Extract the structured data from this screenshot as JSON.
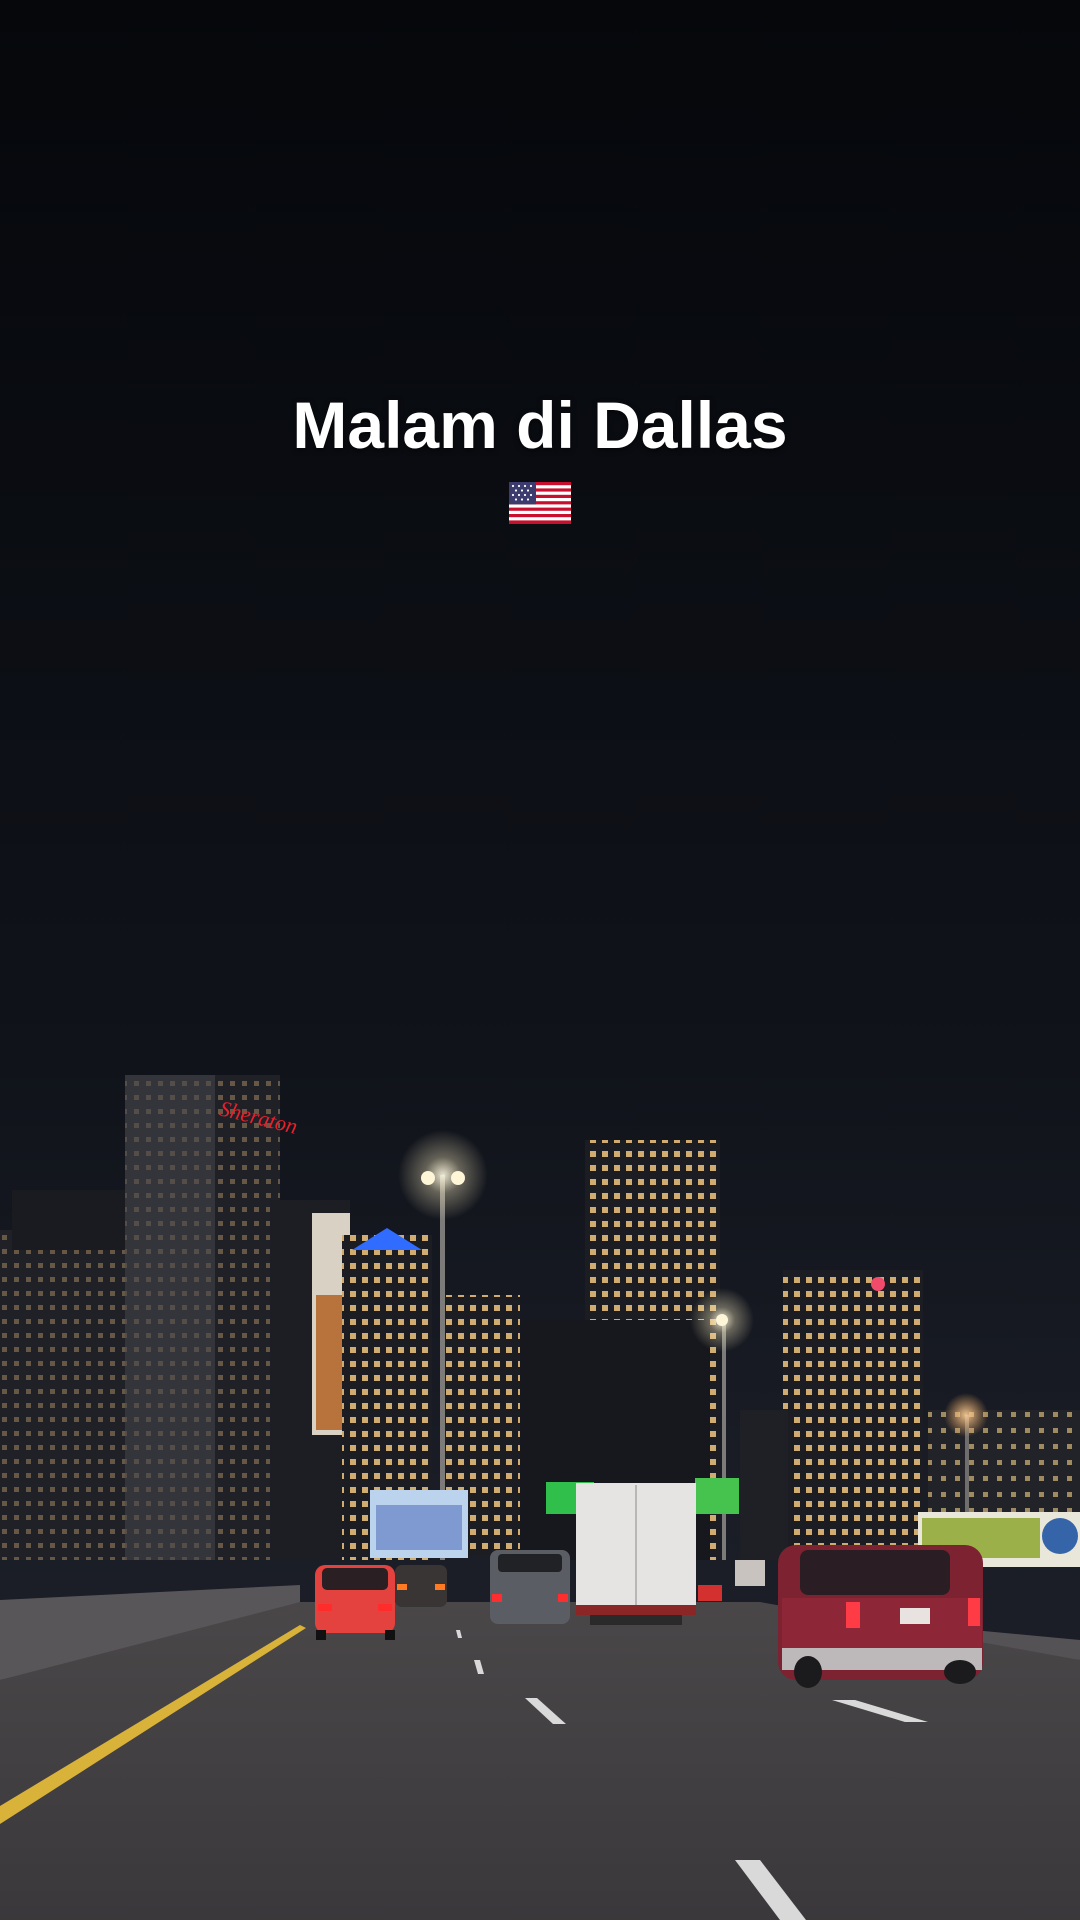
{
  "caption": {
    "title": "Malam di Dallas"
  },
  "emoji": {
    "icon": "us-flag-icon"
  },
  "scene": {
    "description_tags": [
      "night",
      "highway",
      "city-skyline",
      "cars"
    ],
    "colors": {
      "sky_top": "#05070b",
      "sky_bottom": "#1a1d26",
      "road": "#3f3d40",
      "lane_yellow": "#d9b23a",
      "lane_white": "#d9d9d9",
      "building_dark": "#1c1d22",
      "window_light": "#f4cf86",
      "streetlight": "#fff6d8",
      "sign_green": "#2fbf4a",
      "sheraton_red": "#e8202c",
      "tower_blue": "#2f6cff"
    }
  }
}
